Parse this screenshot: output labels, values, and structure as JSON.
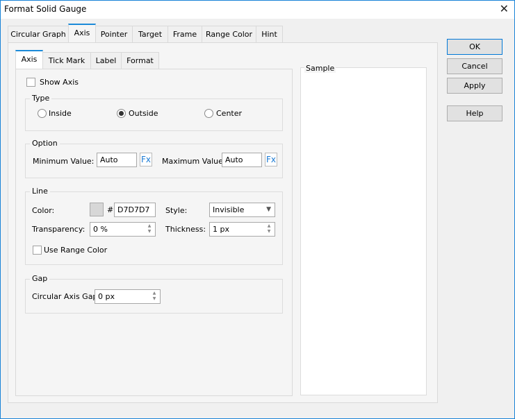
{
  "window": {
    "title": "Format Solid Gauge"
  },
  "tabs": [
    "Circular Graph",
    "Axis",
    "Pointer",
    "Target",
    "Frame",
    "Range Color",
    "Hint"
  ],
  "subtabs": [
    "Axis",
    "Tick Mark",
    "Label",
    "Format"
  ],
  "show_axis": {
    "label": "Show Axis",
    "checked": false
  },
  "type": {
    "title": "Type",
    "options": [
      "Inside",
      "Outside",
      "Center"
    ],
    "selected": "Outside"
  },
  "option": {
    "title": "Option",
    "min_label": "Minimum Value:",
    "min_value": "Auto",
    "max_label": "Maximum Value:",
    "max_value": "Auto",
    "fx": "Fx"
  },
  "line": {
    "title": "Line",
    "color_label": "Color:",
    "hash": "#",
    "color_value": "D7D7D7",
    "color_swatch": "#d7d7d7",
    "style_label": "Style:",
    "style_value": "Invisible",
    "transparency_label": "Transparency:",
    "transparency_value": "0 %",
    "thickness_label": "Thickness:",
    "thickness_value": "1 px",
    "use_range_color": "Use Range Color"
  },
  "gap": {
    "title": "Gap",
    "label": "Circular Axis Gap:",
    "value": "0 px"
  },
  "sample": {
    "title": "Sample"
  },
  "buttons": {
    "ok": "OK",
    "cancel": "Cancel",
    "apply": "Apply",
    "help": "Help"
  }
}
